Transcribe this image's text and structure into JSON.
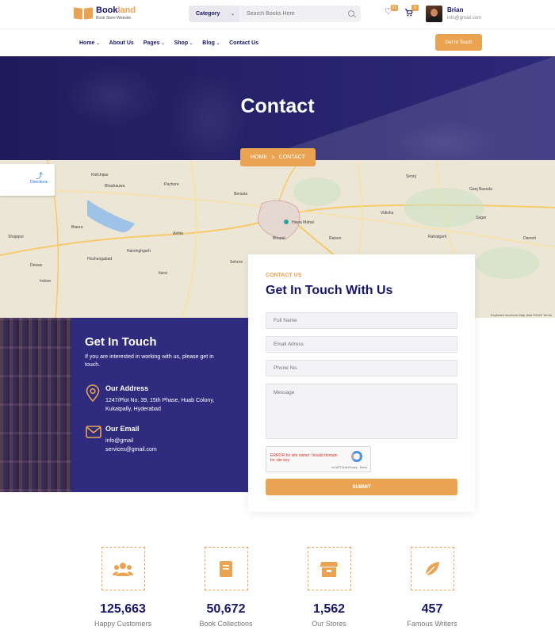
{
  "header": {
    "logo_title_a": "Book",
    "logo_title_b": "land",
    "logo_sub": "Book Store Website",
    "category_label": "Category",
    "search_placeholder": "Search Books Here",
    "wishlist_count": "21",
    "cart_count": "5",
    "user_name": "Brian",
    "user_email": "info@gmail.com"
  },
  "nav": {
    "items": [
      {
        "label": "Home",
        "dropdown": true
      },
      {
        "label": "About Us",
        "dropdown": false
      },
      {
        "label": "Pages",
        "dropdown": true
      },
      {
        "label": "Shop",
        "dropdown": true
      },
      {
        "label": "Blog",
        "dropdown": true
      },
      {
        "label": "Contact Us",
        "dropdown": false
      }
    ],
    "cta": "Get In Touch"
  },
  "hero": {
    "title": "Contact",
    "breadcrumb_home": "HOME",
    "breadcrumb_sep": ">",
    "breadcrumb_current": "CONTACT"
  },
  "map": {
    "directions": "Directions",
    "labels": [
      "Khilchipur",
      "Bhadrauwa",
      "Pachore",
      "Berasia",
      "Hawa Mahal",
      "Raisen",
      "Sironj",
      "Ganj Basoda",
      "Vidisha",
      "Bhopal",
      "Sehore",
      "Ashta",
      "Narsinghgarh",
      "Biaora",
      "Itarsi",
      "Hoshangabad",
      "Sagar",
      "Rahatgarh",
      "Damoh",
      "Shajapur",
      "Dewas",
      "Indore"
    ],
    "credit": "Keyboard shortcuts   Map data ©2022   Terms"
  },
  "touch": {
    "title": "Get In Touch",
    "description": "If you are interested in working with us, please get in touch.",
    "address_title": "Our Address",
    "address_text": "1247/Plot No. 39, 15th Phase, Huab Colony, Kukatpally, Hyderabad",
    "email_title": "Our Email",
    "email_line1": "info@gmail",
    "email_line2": "services@gmail.com"
  },
  "form": {
    "kicker": "CONTACT US",
    "title": "Get In Touch With Us",
    "full_name_placeholder": "Full Name",
    "email_placeholder": "Email Adress",
    "phone_placeholder": "Phone No.",
    "message_placeholder": "Message",
    "captcha_error": "ERROR for site owner: Invalid domain for site key",
    "captcha_sub": "reCAPTCHA Privacy - Terms",
    "submit": "SUBMIT"
  },
  "stats": [
    {
      "value": "125,663",
      "label": "Happy Customers",
      "icon": "users-icon"
    },
    {
      "value": "50,672",
      "label": "Book Collections",
      "icon": "book-icon"
    },
    {
      "value": "1,562",
      "label": "Our Stores",
      "icon": "store-icon"
    },
    {
      "value": "457",
      "label": "Famous Writers",
      "icon": "leaf-icon"
    }
  ],
  "colors": {
    "accent": "#eaa451",
    "primary": "#1a1668",
    "band": "#2f2b7e"
  }
}
